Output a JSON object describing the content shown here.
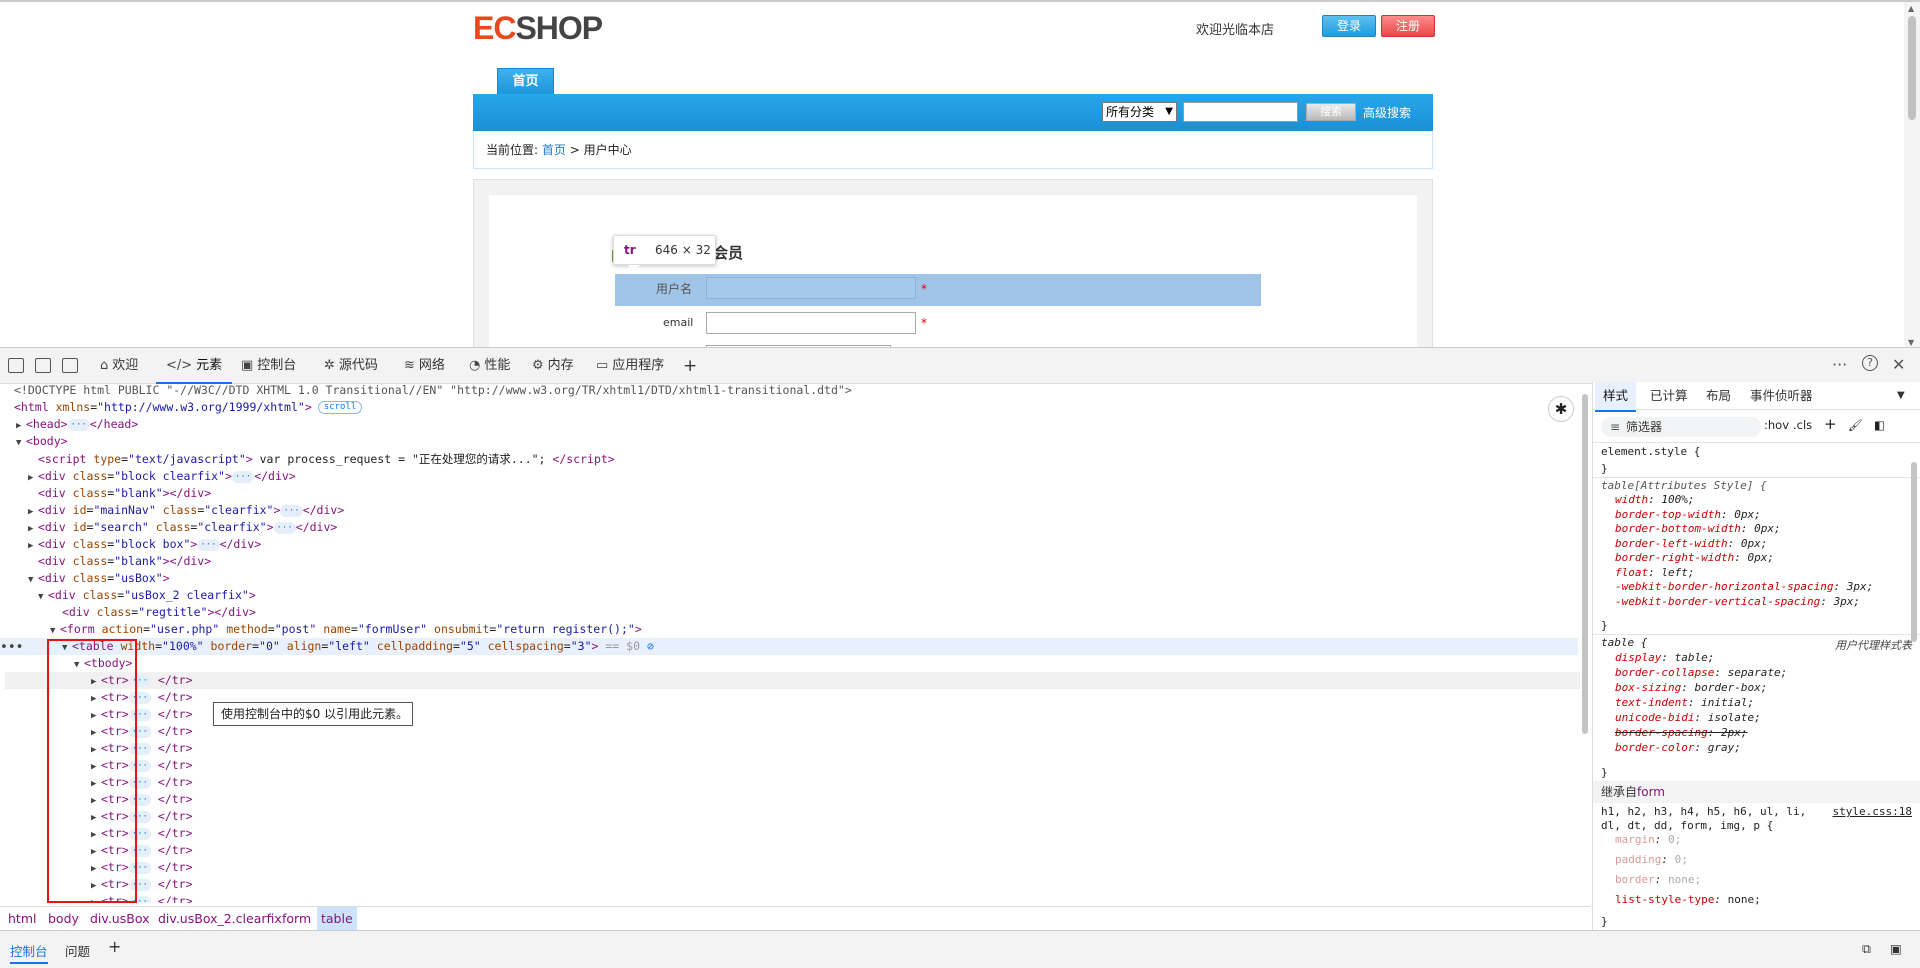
{
  "page": {
    "logo_ec": "EC",
    "logo_shop": "SHOP",
    "welcome": "欢迎光临本店",
    "login_label": "登录",
    "register_label": "注册",
    "nav_home": "首页",
    "category_select": "所有分类",
    "search_placeholder": "",
    "search_button": "搜索",
    "advanced_search": "高级搜索",
    "breadcrumb_prefix": "当前位置:",
    "breadcrumb_home": "首页",
    "breadcrumb_sep": ">",
    "breadcrumb_current": "用户中心",
    "register_title": "会员",
    "username_label": "用户名",
    "email_label": "email",
    "required_mark": "*",
    "highlight_tooltip": {
      "tag": "tr",
      "size": "646 × 32"
    }
  },
  "devtools": {
    "toolbar_tabs": [
      {
        "icon": "home-icon",
        "label": "欢迎"
      },
      {
        "icon": "code-icon",
        "label": "元素"
      },
      {
        "icon": "console-icon",
        "label": "控制台"
      },
      {
        "icon": "bug-icon",
        "label": "源代码"
      },
      {
        "icon": "wifi-icon",
        "label": "网络"
      },
      {
        "icon": "performance-icon",
        "label": "性能"
      },
      {
        "icon": "memory-icon",
        "label": "内存"
      },
      {
        "icon": "app-icon",
        "label": "应用程序"
      }
    ],
    "add_tab": "+",
    "more": "···",
    "help": "?",
    "close": "✕",
    "dom": {
      "doctype": "<!DOCTYPE html PUBLIC \"-//W3C//DTD XHTML 1.0 Transitional//EN\" \"http://www.w3.org/TR/xhtml1/DTD/xhtml1-transitional.dtd\">",
      "html_attr_name": "xmlns",
      "html_attr_value": "\"http://www.w3.org/1999/xhtml\"",
      "scroll_badge": "scroll",
      "script_text": "var process_request = \"正在处理您的请求...\";",
      "form_action": "\"user.php\"",
      "form_method": "\"post\"",
      "form_name": "\"formUser\"",
      "form_onsubmit": "\"return register();\"",
      "table_width": "\"100%\"",
      "table_border": "\"0\"",
      "table_align": "\"left\"",
      "table_cellpadding": "\"5\"",
      "table_cellspacing": "\"3\"",
      "dollar_ref": "== $0",
      "tip": "使用控制台中的$0 以引用此元素。"
    },
    "breadcrumbs": [
      "html",
      "body",
      "div.usBox",
      "div.usBox_2.clearfix",
      "form",
      "table"
    ],
    "styles": {
      "tabs": [
        "样式",
        "已计算",
        "布局",
        "事件侦听器"
      ],
      "filter": "筛选器",
      "hov": ":hov",
      "cls": ".cls",
      "element_style": "element.style {",
      "table_attr_selector": "table[Attributes Style] {",
      "table_attr_props": [
        [
          "width",
          "100%;"
        ],
        [
          "border-top-width",
          "0px;"
        ],
        [
          "border-bottom-width",
          "0px;"
        ],
        [
          "border-left-width",
          "0px;"
        ],
        [
          "border-right-width",
          "0px;"
        ],
        [
          "float",
          "left;"
        ],
        [
          "-webkit-border-horizontal-spacing",
          "3px;"
        ],
        [
          "-webkit-border-vertical-spacing",
          "3px;"
        ]
      ],
      "table_ua_selector": "table {",
      "ua_label": "用户代理样式表",
      "table_ua_props": [
        [
          "display",
          "table;"
        ],
        [
          "border-collapse",
          "separate;"
        ],
        [
          "box-sizing",
          "border-box;"
        ],
        [
          "text-indent",
          "initial;"
        ],
        [
          "unicode-bidi",
          "isolate;"
        ],
        [
          "border-spacing",
          "2px;"
        ],
        [
          "border-color",
          "gray;"
        ]
      ],
      "inherited_prefix": "继承自",
      "inherited_from": "form",
      "inherited_selector_1": "h1, h2, h3, h4, h5, h6, ul, li,",
      "inherited_selector_2": "dl, dt, dd, form, img, p {",
      "inherited_source": "style.css:18",
      "inherited_props": [
        [
          "margin",
          "0;"
        ],
        [
          "padding",
          "0;"
        ],
        [
          "border",
          "none;"
        ],
        [
          "list-style-type",
          "none;"
        ]
      ]
    },
    "drawer_tabs": [
      "控制台",
      "问题"
    ]
  }
}
